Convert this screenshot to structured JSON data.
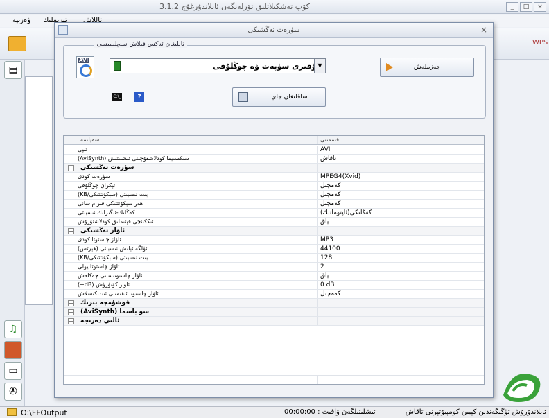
{
  "app": {
    "title": "كۆپ تەشكىلاتلىق تۆرلەنگەن ئابلاندۇرغۇچ 3.1.2",
    "menu": [
      "ۋەزىپە",
      "تىزىملىك",
      "تاللاش"
    ],
    "toolbar_right": "WPS",
    "status_path": "O:\\FFOutput",
    "status_time": "00:00:00 : ئىشلىتىلگەن ۋاقىت",
    "status_right": "ئابلاندۇرۇش تۈگىگەندىن كېيىن كومپيۇتېرنى تاقاش"
  },
  "dialog": {
    "title": "سۈرەت تەڭشىكى",
    "group_legend": "تاللىغان ئەكس قىلاش سەپلىمىسى",
    "format_icon_label": "AVI",
    "format_value": "يۇقىرى سۈپەت ۋە چوڭلۇقى",
    "ok_label": "جەزملەش",
    "cmd_label": "C:\\_",
    "help_label": "?",
    "save_label": "ساقلىغان جاي"
  },
  "grid": {
    "header_name": "سەپلىمە",
    "header_value": "قىممىتى",
    "rows": [
      {
        "kind": "prop",
        "name": "تىپى",
        "value": "AVI"
      },
      {
        "kind": "prop",
        "name": "(AviSynth) سىكسىيما كودلاشقۇچىنى ئىشلىتىش",
        "value": "تاقاش"
      },
      {
        "kind": "cat",
        "name": "سۈرەت تەڭشىكى",
        "value": "",
        "sign": "−"
      },
      {
        "kind": "prop",
        "name": "سۈرەت كودى",
        "value": "MPEG4(Xvid)"
      },
      {
        "kind": "prop",
        "name": "ئېكران چوڭلۇقى",
        "value": "كەمچىل"
      },
      {
        "kind": "prop",
        "name": "(KB/سېكۇنتتىكى) بىت نىسبىتى",
        "value": "كەمچىل"
      },
      {
        "kind": "prop",
        "name": "ھەر سېكۇنتتىكى فىرام سانى",
        "value": "كەمچىل"
      },
      {
        "kind": "prop",
        "name": "كەڭلىك-ئېگىزلىك نىسبىتى",
        "value": "(ئاپتوماتىك)كەڭلىكى"
      },
      {
        "kind": "prop",
        "name": "ئىككىنچى قېتىملىق كودلاشتۇرۇش",
        "value": "ياق"
      },
      {
        "kind": "cat",
        "name": "ئاۋاز تەڭشىكى",
        "value": "",
        "sign": "−"
      },
      {
        "kind": "prop",
        "name": "ئاۋاز چاستوتا كودى",
        "value": "MP3"
      },
      {
        "kind": "prop",
        "name": "(ھېرتس) ئۈلگە ئېلىش نىسبىتى",
        "value": "44100"
      },
      {
        "kind": "prop",
        "name": "(KB/سېكۇنتتىكى) بىت نىسبىتى",
        "value": "128"
      },
      {
        "kind": "prop",
        "name": "ئاۋاز چاستوتا يولى",
        "value": "2"
      },
      {
        "kind": "prop",
        "name": "ئاۋاز چاستوتىسىنى چەكلەش",
        "value": "ياق"
      },
      {
        "kind": "prop",
        "name": "(+dB) ئاۋاز كۆتۈرۈش",
        "value": "0 dB"
      },
      {
        "kind": "prop",
        "name": "ئاۋاز چاستوتا ئېقىمىنى ئىندېكىسلاش",
        "value": "كەمچىل"
      },
      {
        "kind": "cat",
        "name": "قوشۇمچە بىرىك",
        "value": "",
        "sign": "+"
      },
      {
        "kind": "cat",
        "name": "(AviSynth) سۈ باسما",
        "value": "",
        "sign": "+"
      },
      {
        "kind": "cat",
        "name": "ئالىي دەرىجە",
        "value": "",
        "sign": "+"
      }
    ]
  }
}
